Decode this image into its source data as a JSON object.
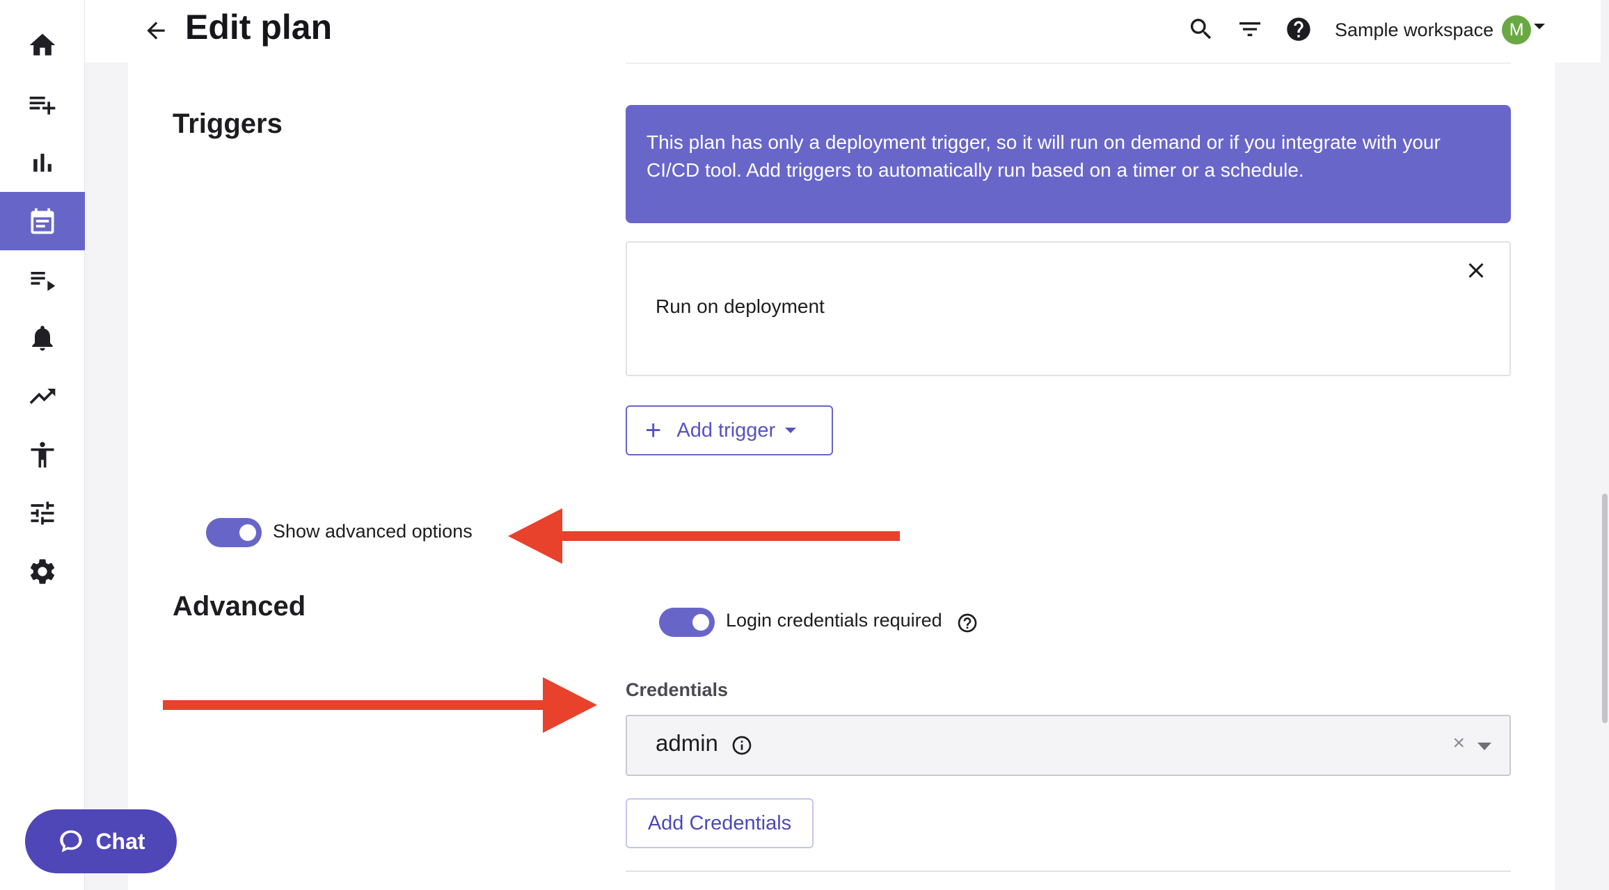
{
  "header": {
    "title": "Edit plan",
    "workspace_name": "Sample workspace",
    "avatar_initial": "M",
    "avatar_color": "#6aa844"
  },
  "sidebar": {
    "accent_color": "#6766c8",
    "items": [
      {
        "name": "home",
        "icon": "home-icon",
        "active": false
      },
      {
        "name": "create-test",
        "icon": "playlist-add-icon",
        "active": false
      },
      {
        "name": "dashboard",
        "icon": "bar-chart-icon",
        "active": false
      },
      {
        "name": "plans",
        "icon": "calendar-icon",
        "active": true
      },
      {
        "name": "runs",
        "icon": "playlist-play-icon",
        "active": false
      },
      {
        "name": "notifications",
        "icon": "bell-icon",
        "active": false
      },
      {
        "name": "trends",
        "icon": "trending-up-icon",
        "active": false
      },
      {
        "name": "accessibility",
        "icon": "accessibility-icon",
        "active": false
      },
      {
        "name": "tuning",
        "icon": "tune-icon",
        "active": false
      },
      {
        "name": "settings",
        "icon": "gear-icon",
        "active": false
      }
    ]
  },
  "triggers": {
    "title": "Triggers",
    "banner_text": "This plan has only a deployment trigger, so it will run on demand or if you integrate with your CI/CD tool. Add triggers to automatically run based on a timer or a schedule.",
    "banner_color": "#6966c9",
    "trigger_items": [
      "Run on deployment"
    ],
    "add_trigger_label": "Add trigger"
  },
  "advanced_toggle": {
    "label": "Show advanced options",
    "on": true
  },
  "advanced": {
    "title": "Advanced",
    "login_toggle_label": "Login credentials required",
    "login_toggle_on": true,
    "credentials_label": "Credentials",
    "credentials_value": "admin",
    "clear_symbol": "×",
    "add_credentials_label": "Add Credentials"
  },
  "annotations": {
    "arrow_color": "#e8412c"
  },
  "chat": {
    "label": "Chat"
  }
}
